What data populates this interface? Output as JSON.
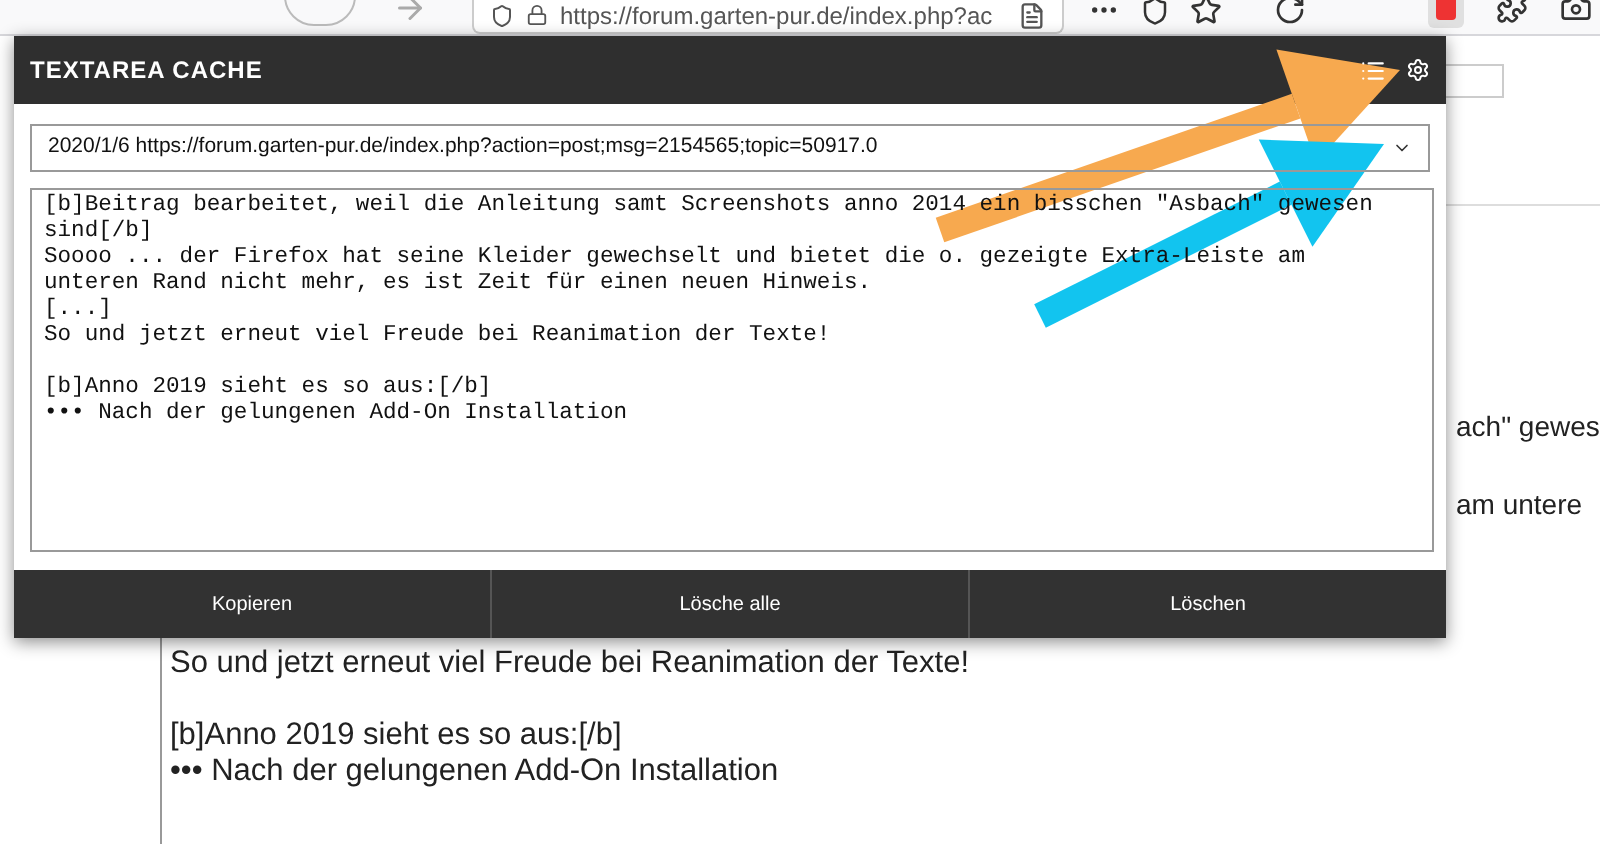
{
  "browser": {
    "url": "https://forum.garten-pur.de/index.php?ac"
  },
  "page": {
    "right_fragments": [
      "ach\" gewes",
      "am untere"
    ],
    "lines": [
      "So und jetzt erneut viel Freude bei Reanimation der Texte!",
      "[b]Anno 2019 sieht es so aus:[/b]",
      "••• Nach der gelungenen Add-On Installation"
    ]
  },
  "popup": {
    "title": "TEXTAREA CACHE",
    "entry_select": {
      "value": "2020/1/6 https://forum.garten-pur.de/index.php?action=post;msg=2154565;topic=50917.0"
    },
    "textarea": {
      "value": "[b]Beitrag bearbeitet, weil die Anleitung samt Screenshots anno 2014 ein bisschen \"Asbach\" gewesen sind[/b]\nSoooo ... der Firefox hat seine Kleider gewechselt und bietet die o. gezeigte Extra-Leiste am unteren Rand nicht mehr, es ist Zeit für einen neuen Hinweis.\n[...]\nSo und jetzt erneut viel Freude bei Reanimation der Texte!\n\n[b]Anno 2019 sieht es so aus:[/b]\n••• Nach der gelungenen Add-On Installation"
    },
    "buttons": [
      {
        "label": "Kopieren"
      },
      {
        "label": "Lösche alle"
      },
      {
        "label": "Löschen"
      }
    ]
  },
  "annotations": [
    {
      "kind": "arrow",
      "color": "#f7a94f"
    },
    {
      "kind": "arrow",
      "color": "#12c4ef"
    }
  ]
}
